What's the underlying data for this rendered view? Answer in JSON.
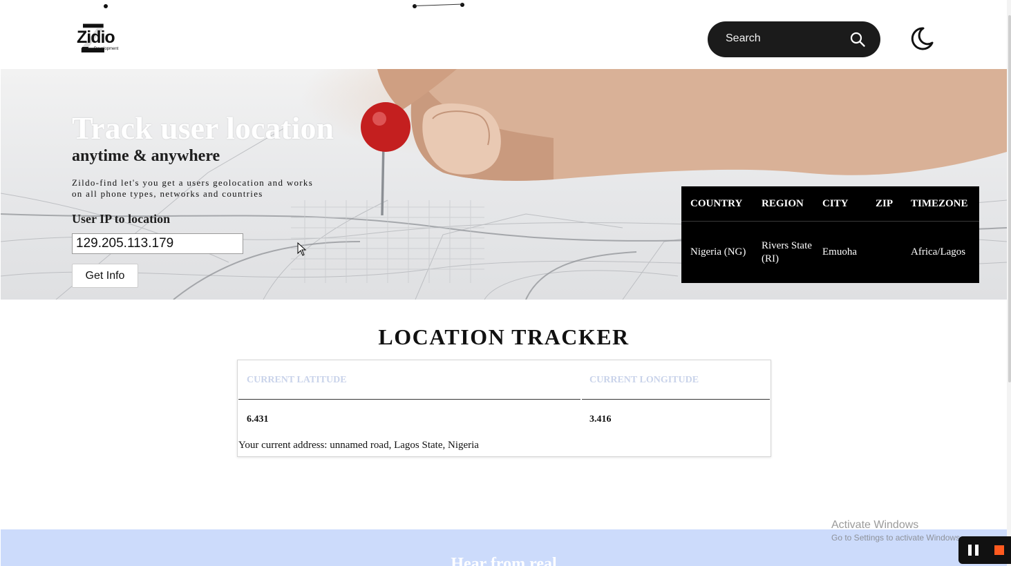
{
  "header": {
    "logo": {
      "word": "Zidio",
      "sub": "Development",
      "letter": "Z"
    },
    "search": {
      "placeholder": "Search"
    },
    "icons": [
      "search-icon",
      "moon-icon"
    ]
  },
  "hero": {
    "title": "Track user location",
    "subtitle": "anytime & anywhere",
    "description": "Zildo-find let's you get a users geolocation and works on all phone types, networks and countries",
    "ip_label": "User IP to location",
    "ip_value": "129.205.113.179",
    "button_label": "Get Info"
  },
  "geo_table": {
    "headers": [
      "COUNTRY",
      "REGION",
      "CITY",
      "ZIP",
      "TIMEZONE"
    ],
    "row": [
      "Nigeria (NG)",
      "Rivers State (RI)",
      "Emuoha",
      "",
      "Africa/Lagos"
    ]
  },
  "tracker": {
    "title": "LOCATION TRACKER",
    "lat_label": "CURRENT LATITUDE",
    "lon_label": "CURRENT LONGITUDE",
    "lat_value": "6.431",
    "lon_value": "3.416",
    "address": "Your current address: unnamed road, Lagos State, Nigeria"
  },
  "testimonials": {
    "title": "Hear from real"
  },
  "windows_notice": {
    "title": "Activate Windows",
    "subtitle": "Go to Settings to activate Windows."
  },
  "colors": {
    "accent_dark": "#1b1b1b",
    "header_muted_blue": "#c9d3ea",
    "band_blue": "#ccdbfb",
    "record_orange": "#ff5a1f"
  }
}
